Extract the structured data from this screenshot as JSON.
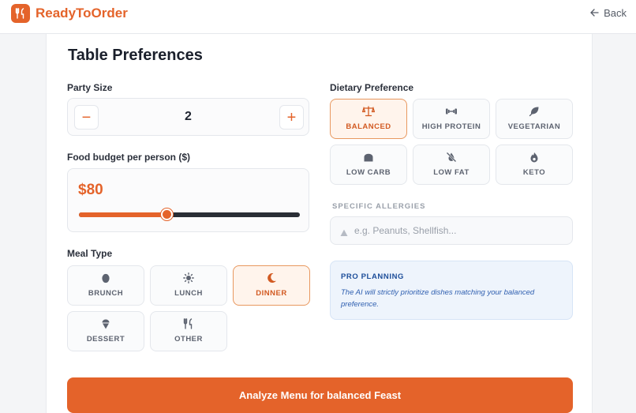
{
  "header": {
    "brand": "ReadyToOrder",
    "back_label": "Back"
  },
  "colors": {
    "accent": "#e4632a",
    "active_bg": "#fff4ec",
    "info_bg": "#eef4fc",
    "info_text": "#1d4e9a"
  },
  "page": {
    "title": "Table Preferences"
  },
  "party": {
    "label": "Party Size",
    "value": "2",
    "minus": "−",
    "plus": "+"
  },
  "budget": {
    "label": "Food budget per person ($)",
    "value": "$80",
    "level_fraction": 0.4
  },
  "meal": {
    "label": "Meal Type",
    "options": [
      {
        "label": "BRUNCH",
        "icon": "egg-icon"
      },
      {
        "label": "LUNCH",
        "icon": "sun-icon"
      },
      {
        "label": "DINNER",
        "icon": "moon-icon",
        "selected": true
      },
      {
        "label": "DESSERT",
        "icon": "ice-cream-icon"
      },
      {
        "label": "OTHER",
        "icon": "utensils-icon"
      }
    ]
  },
  "dietary": {
    "label": "Dietary Preference",
    "options": [
      {
        "label": "BALANCED",
        "icon": "scale-icon",
        "selected": true
      },
      {
        "label": "HIGH PROTEIN",
        "icon": "dumbbell-icon"
      },
      {
        "label": "VEGETARIAN",
        "icon": "leaf-icon"
      },
      {
        "label": "LOW CARB",
        "icon": "bread-icon"
      },
      {
        "label": "LOW FAT",
        "icon": "no-drop-icon"
      },
      {
        "label": "KETO",
        "icon": "flame-icon"
      }
    ]
  },
  "allergies": {
    "label": "SPECIFIC ALLERGIES",
    "placeholder": "e.g. Peanuts, Shellfish...",
    "value": ""
  },
  "pro": {
    "title": "PRO PLANNING",
    "text": "The AI will strictly prioritize dishes matching your balanced preference."
  },
  "cta": {
    "label": "Analyze Menu for balanced Feast"
  }
}
